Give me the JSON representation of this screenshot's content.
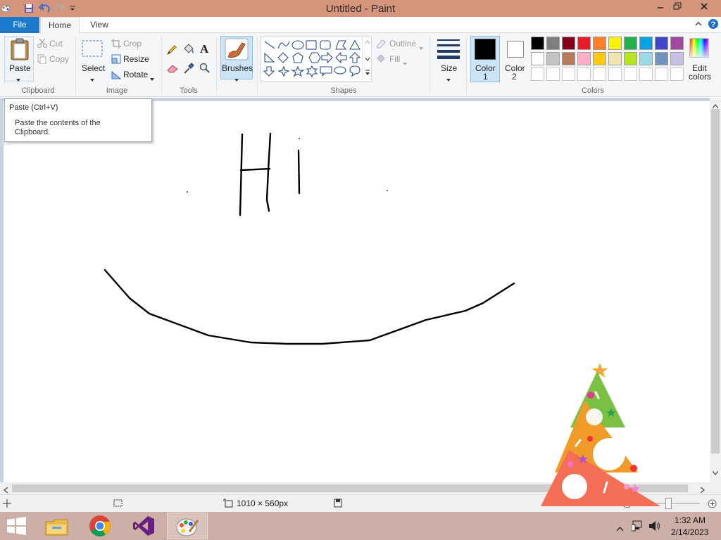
{
  "window": {
    "title": "Untitled - Paint"
  },
  "tabs": {
    "file": "File",
    "home": "Home",
    "view": "View"
  },
  "clipboard": {
    "paste": "Paste",
    "cut": "Cut",
    "copy": "Copy",
    "label": "Clipboard"
  },
  "image": {
    "select": "Select",
    "crop": "Crop",
    "resize": "Resize",
    "rotate": "Rotate",
    "label": "Image"
  },
  "tools": {
    "label": "Tools",
    "text_glyph": "A"
  },
  "brushes": {
    "label": "Brushes"
  },
  "shapes": {
    "outline": "Outline",
    "fill": "Fill",
    "label": "Shapes"
  },
  "size": {
    "label": "Size"
  },
  "colors": {
    "color1": "Color",
    "color1_num": "1",
    "color2": "Color",
    "color2_num": "2",
    "edit_line1": "Edit",
    "edit_line2": "colors",
    "label": "Colors",
    "color1_value": "#000000",
    "color2_value": "#ffffff",
    "palette_row1": [
      "#000000",
      "#7f7f7f",
      "#880015",
      "#ed1c24",
      "#ff7f27",
      "#fff200",
      "#22b14c",
      "#00a2e8",
      "#3f48cc",
      "#a349a4"
    ],
    "palette_row2": [
      "#ffffff",
      "#c3c3c3",
      "#b97a57",
      "#ffaec9",
      "#ffc90e",
      "#efe4b0",
      "#b5e61d",
      "#99d9ea",
      "#7092be",
      "#c8bfe7"
    ]
  },
  "tooltip": {
    "title": "Paste (Ctrl+V)",
    "body": "Paste the contents of the Clipboard."
  },
  "status": {
    "canvas_size": "1010 × 560px",
    "zoom": "100%"
  },
  "clock": {
    "time": "1:32 AM",
    "date": "2/14/2023"
  },
  "canvas": {
    "text": "Hi"
  }
}
